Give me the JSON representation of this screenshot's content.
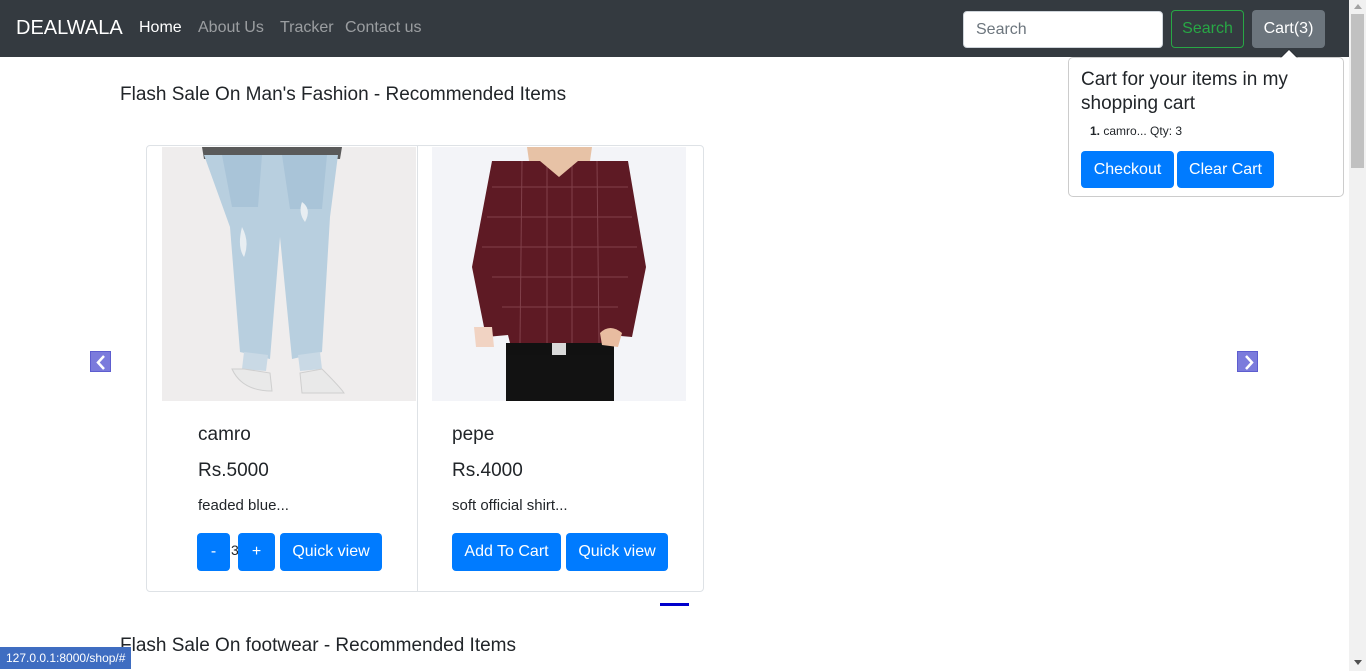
{
  "navbar": {
    "brand": "DEALWALA",
    "links": [
      "Home",
      "About Us",
      "Tracker",
      "Contact us"
    ],
    "search_placeholder": "Search",
    "search_button": "Search",
    "cart_button": "Cart(3)"
  },
  "popover": {
    "title": "Cart for your items in my shopping cart",
    "items": [
      {
        "num": "1.",
        "text": "camro... Qty: 3"
      }
    ],
    "checkout_label": "Checkout",
    "clear_label": "Clear Cart"
  },
  "sections": [
    {
      "title": "Flash Sale On Man's Fashion - Recommended Items"
    },
    {
      "title": "Flash Sale On footwear - Recommended Items"
    }
  ],
  "products": [
    {
      "name": "camro",
      "price": "Rs.5000",
      "description": "feaded blue...",
      "minus_label": "-",
      "qty": "3",
      "plus_label": "+",
      "quickview_label": "Quick view"
    },
    {
      "name": "pepe",
      "price": "Rs.4000",
      "description": "soft official shirt...",
      "add_label": "Add To Cart",
      "quickview_label": "Quick view"
    }
  ],
  "status_bar": "127.0.0.1:8000/shop/#",
  "colors": {
    "navbar": "#343a40",
    "primary": "#007bff",
    "success": "#28a745",
    "secondary": "#6c757d"
  },
  "icons": {
    "prev": "chevron-left-icon",
    "next": "chevron-right-icon"
  }
}
